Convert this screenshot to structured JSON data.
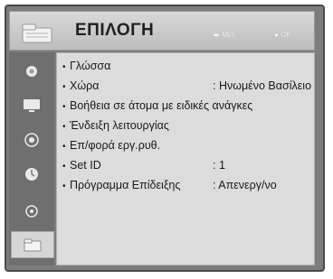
{
  "header": {
    "title": "ΕΠΙΛΟΓΗ",
    "move_hint": "Μετ.",
    "ok_hint": "OK"
  },
  "sidebar": {
    "items": [
      {
        "icon": "picture-icon"
      },
      {
        "icon": "tv-screen-icon"
      },
      {
        "icon": "speaker-icon"
      },
      {
        "icon": "clock-icon"
      },
      {
        "icon": "lock-icon"
      },
      {
        "icon": "option-folder-icon"
      }
    ],
    "active_index": 5
  },
  "menu": {
    "items": [
      {
        "label": "Γλώσσα",
        "value": ""
      },
      {
        "label": "Χώρα",
        "value": ": Ηνωμένο Βασίλειο"
      },
      {
        "label": "Βοήθεια σε άτομα με ειδικές ανάγκες",
        "value": ""
      },
      {
        "label": "Ένδειξη λειτουργίας",
        "value": ""
      },
      {
        "label": "Επ/φορά εργ.ρυθ.",
        "value": ""
      },
      {
        "label": "Set ID",
        "value": ": 1"
      },
      {
        "label": "Πρόγραμμα Επίδειξης",
        "value": ": Απενεργ/νο"
      }
    ]
  },
  "colors": {
    "frame": "#7d7d7d",
    "panel": "#dcdcdc",
    "header": "#cfcfcf"
  }
}
